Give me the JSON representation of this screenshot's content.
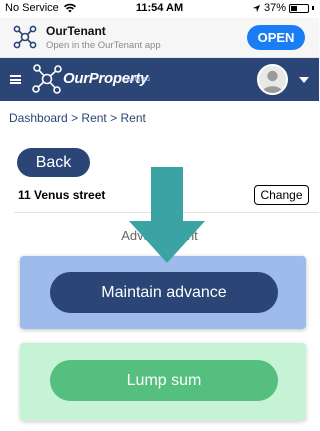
{
  "status_bar": {
    "carrier": "No Service",
    "time": "11:54 AM",
    "battery": "37%",
    "battery_level": 0.37,
    "icons": [
      "wifi-icon",
      "location-icon",
      "battery-icon"
    ]
  },
  "app_banner": {
    "title": "OurTenant",
    "subtitle": "Open in the OurTenant app",
    "open_label": "OPEN",
    "icon": "ourtenant-logo-icon",
    "accent": "#1b7df3"
  },
  "nav": {
    "brand": "OurProperty",
    "brand_domain": ".com.au",
    "icons": [
      "hamburger-menu-icon",
      "ourproperty-logo-icon",
      "user-avatar-icon",
      "dropdown-caret-icon"
    ],
    "background": "#2a4576"
  },
  "breadcrumb": {
    "items": [
      "Dashboard",
      "Rent",
      "Rent"
    ],
    "separator": ">"
  },
  "page": {
    "back_label": "Back",
    "property": "11 Venus street",
    "change_label": "Change",
    "section_title": "Advance rent",
    "options": {
      "advance_label": "Maintain advance",
      "lump_label": "Lump sum"
    }
  },
  "colors": {
    "primary": "#2a4576",
    "advance_card": "#9dbbeb",
    "lump_card": "#c6f2d6",
    "lump_button": "#55bf7f",
    "arrow": "#3ba3a3"
  }
}
